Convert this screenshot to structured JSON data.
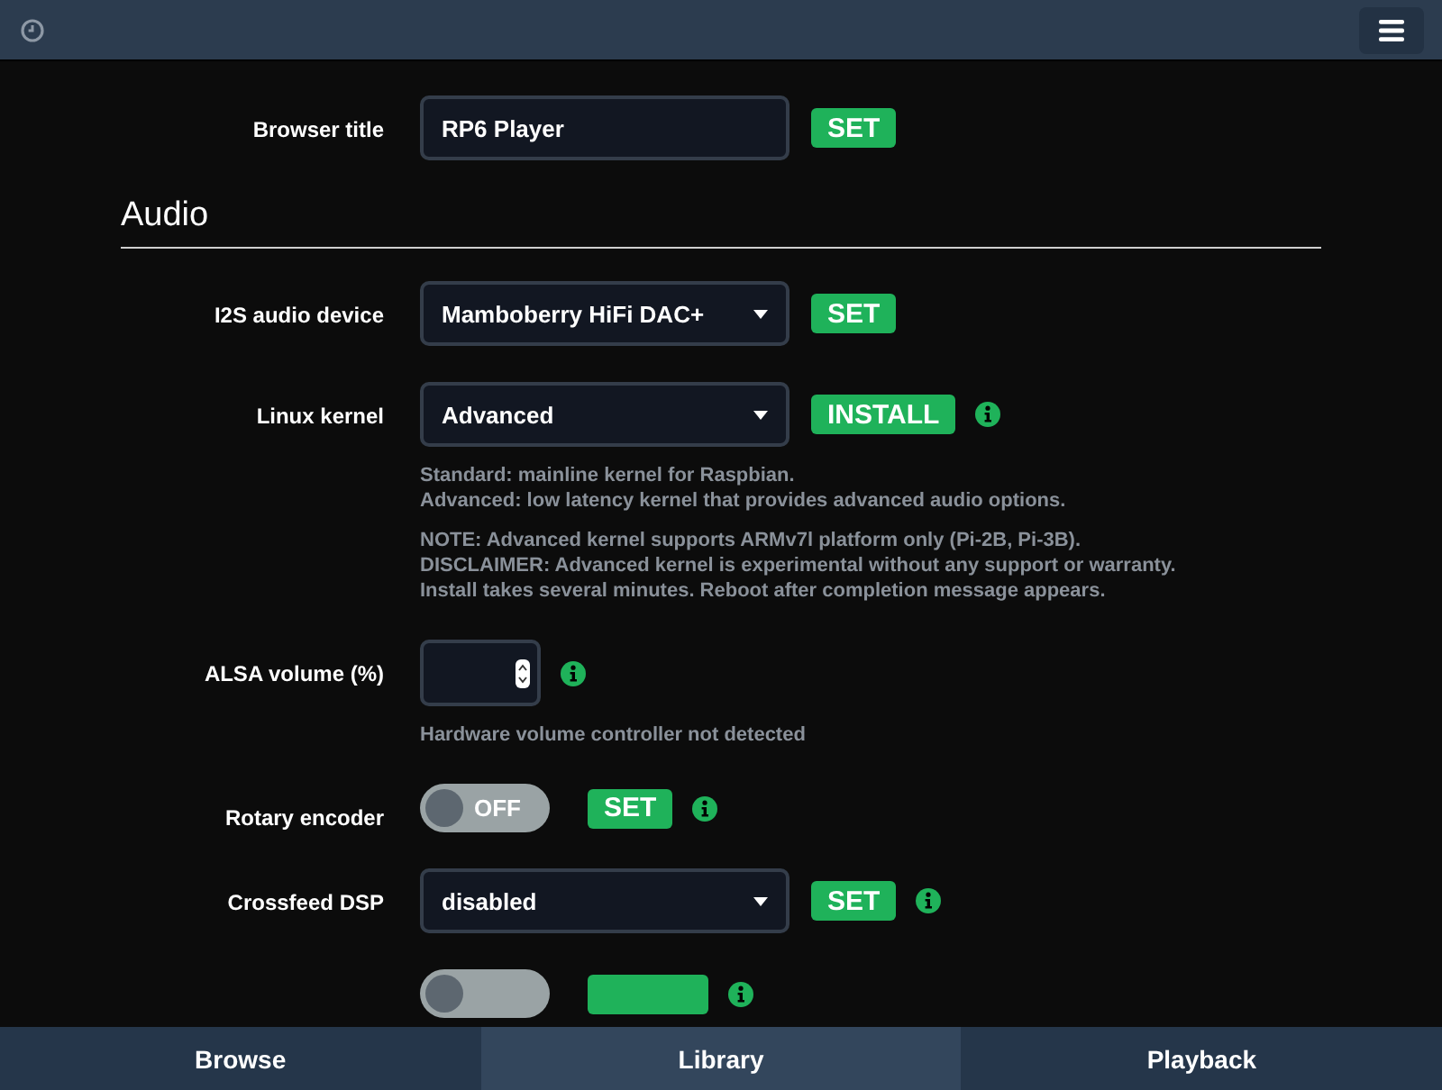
{
  "top_rows": [
    {
      "kind": "text",
      "label": "Browser title",
      "value": "RP6 Player",
      "button": "SET",
      "info": false,
      "help": []
    }
  ],
  "audio": {
    "title": "Audio",
    "rows": [
      {
        "kind": "select",
        "label": "I2S audio device",
        "value": "Mamboberry HiFi DAC+",
        "button": "SET",
        "info": false,
        "help": []
      },
      {
        "kind": "select",
        "label": "Linux kernel",
        "value": "Advanced",
        "button": "INSTALL",
        "info": true,
        "help": [
          "Standard: mainline kernel for Raspbian.\nAdvanced: low latency kernel that provides advanced audio options.",
          "NOTE: Advanced kernel supports ARMv7l platform only (Pi-2B, Pi-3B).\nDISCLAIMER: Advanced kernel is experimental without any support or warranty.\nInstall takes several minutes. Reboot after completion message appears."
        ]
      },
      {
        "kind": "number",
        "label": "ALSA volume (%)",
        "info": true,
        "help": [
          "Hardware volume controller not detected"
        ]
      },
      {
        "kind": "toggle",
        "label": "Rotary encoder",
        "on": false,
        "state_text": "OFF",
        "button": "SET",
        "info": true,
        "help": []
      },
      {
        "kind": "select",
        "label": "Crossfeed DSP",
        "value": "disabled",
        "button": "SET",
        "info": true,
        "help": []
      },
      {
        "kind": "toggle",
        "on": false,
        "info": true,
        "help": []
      }
    ]
  },
  "footer_tabs": [
    {
      "label": "Browse",
      "selected": false
    },
    {
      "label": "Library",
      "selected": true
    },
    {
      "label": "Playback",
      "selected": false
    }
  ]
}
